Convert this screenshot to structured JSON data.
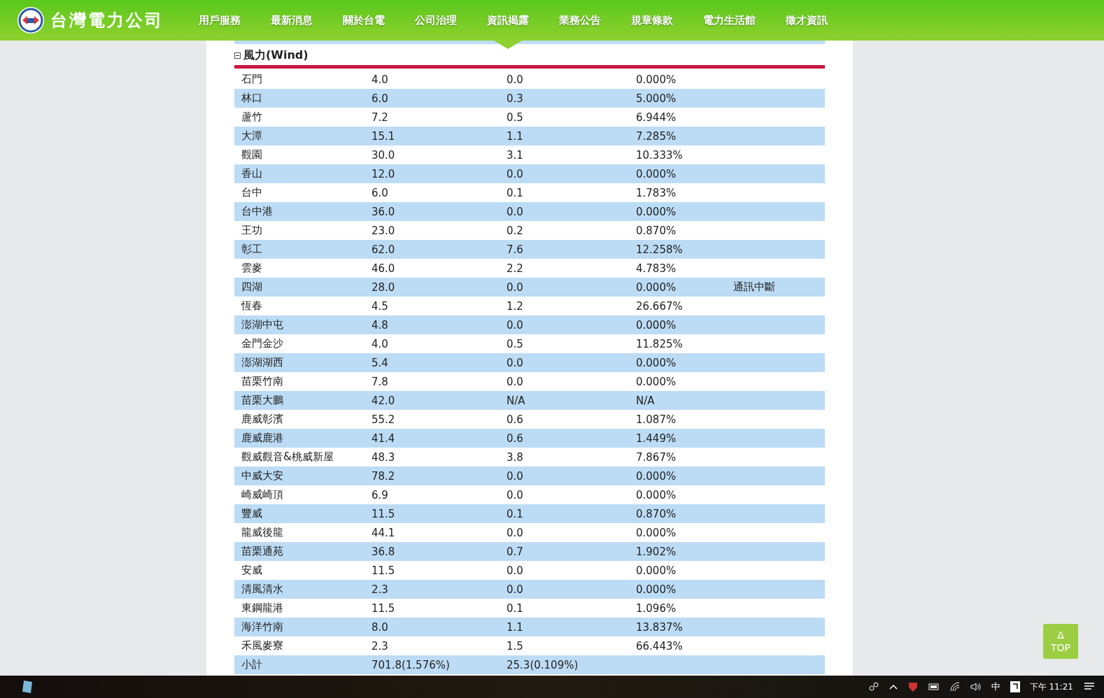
{
  "header": {
    "logo_text": "台灣電力公司",
    "nav": [
      {
        "label": "用戶服務",
        "selected": false
      },
      {
        "label": "最新消息",
        "selected": false
      },
      {
        "label": "關於台電",
        "selected": false
      },
      {
        "label": "公司治理",
        "selected": false
      },
      {
        "label": "資訊揭露",
        "selected": true
      },
      {
        "label": "業務公告",
        "selected": false
      },
      {
        "label": "規章條款",
        "selected": false
      },
      {
        "label": "電力生活館",
        "selected": false
      },
      {
        "label": "徵才資訊",
        "selected": false
      }
    ]
  },
  "section": {
    "title": "風力(Wind)",
    "expanded": true,
    "rows": [
      {
        "name": "石門",
        "capacity": "4.0",
        "output": "0.0",
        "ratio": "0.000%"
      },
      {
        "name": "林口",
        "capacity": "6.0",
        "output": "0.3",
        "ratio": "5.000%"
      },
      {
        "name": "蘆竹",
        "capacity": "7.2",
        "output": "0.5",
        "ratio": "6.944%"
      },
      {
        "name": "大潭",
        "capacity": "15.1",
        "output": "1.1",
        "ratio": "7.285%"
      },
      {
        "name": "觀園",
        "capacity": "30.0",
        "output": "3.1",
        "ratio": "10.333%"
      },
      {
        "name": "香山",
        "capacity": "12.0",
        "output": "0.0",
        "ratio": "0.000%"
      },
      {
        "name": "台中",
        "capacity": "6.0",
        "output": "0.1",
        "ratio": "1.783%"
      },
      {
        "name": "台中港",
        "capacity": "36.0",
        "output": "0.0",
        "ratio": "0.000%"
      },
      {
        "name": "王功",
        "capacity": "23.0",
        "output": "0.2",
        "ratio": "0.870%"
      },
      {
        "name": "彰工",
        "capacity": "62.0",
        "output": "7.6",
        "ratio": "12.258%"
      },
      {
        "name": "雲麥",
        "capacity": "46.0",
        "output": "2.2",
        "ratio": "4.783%"
      },
      {
        "name": "四湖",
        "capacity": "28.0",
        "output": "0.0",
        "ratio": "0.000%",
        "note": "通訊中斷"
      },
      {
        "name": "恆春",
        "capacity": "4.5",
        "output": "1.2",
        "ratio": "26.667%"
      },
      {
        "name": "澎湖中屯",
        "capacity": "4.8",
        "output": "0.0",
        "ratio": "0.000%"
      },
      {
        "name": "金門金沙",
        "capacity": "4.0",
        "output": "0.5",
        "ratio": "11.825%"
      },
      {
        "name": "澎湖湖西",
        "capacity": "5.4",
        "output": "0.0",
        "ratio": "0.000%"
      },
      {
        "name": "苗栗竹南",
        "capacity": "7.8",
        "output": "0.0",
        "ratio": "0.000%"
      },
      {
        "name": "苗栗大鵬",
        "capacity": "42.0",
        "output": "N/A",
        "ratio": "N/A"
      },
      {
        "name": "鹿威彰濱",
        "capacity": "55.2",
        "output": "0.6",
        "ratio": "1.087%"
      },
      {
        "name": "鹿威鹿港",
        "capacity": "41.4",
        "output": "0.6",
        "ratio": "1.449%"
      },
      {
        "name": "觀威觀音&桃威新屋",
        "capacity": "48.3",
        "output": "3.8",
        "ratio": "7.867%"
      },
      {
        "name": "中威大安",
        "capacity": "78.2",
        "output": "0.0",
        "ratio": "0.000%"
      },
      {
        "name": "崎威崎頂",
        "capacity": "6.9",
        "output": "0.0",
        "ratio": "0.000%"
      },
      {
        "name": "豐威",
        "capacity": "11.5",
        "output": "0.1",
        "ratio": "0.870%"
      },
      {
        "name": "龍威後龍",
        "capacity": "44.1",
        "output": "0.0",
        "ratio": "0.000%"
      },
      {
        "name": "苗栗通苑",
        "capacity": "36.8",
        "output": "0.7",
        "ratio": "1.902%"
      },
      {
        "name": "安威",
        "capacity": "11.5",
        "output": "0.0",
        "ratio": "0.000%"
      },
      {
        "name": "清風清水",
        "capacity": "2.3",
        "output": "0.0",
        "ratio": "0.000%"
      },
      {
        "name": "東鋼龍港",
        "capacity": "11.5",
        "output": "0.1",
        "ratio": "1.096%"
      },
      {
        "name": "海洋竹南",
        "capacity": "8.0",
        "output": "1.1",
        "ratio": "13.837%"
      },
      {
        "name": "禾風麥寮",
        "capacity": "2.3",
        "output": "1.5",
        "ratio": "66.443%"
      },
      {
        "name": "小計",
        "capacity": "701.8(1.576%)",
        "output": "25.3(0.109%)"
      }
    ]
  },
  "top_button": {
    "arrow": "Δ",
    "label": "TOP"
  },
  "taskbar": {
    "ime": "中",
    "time": "下午 11:21"
  }
}
